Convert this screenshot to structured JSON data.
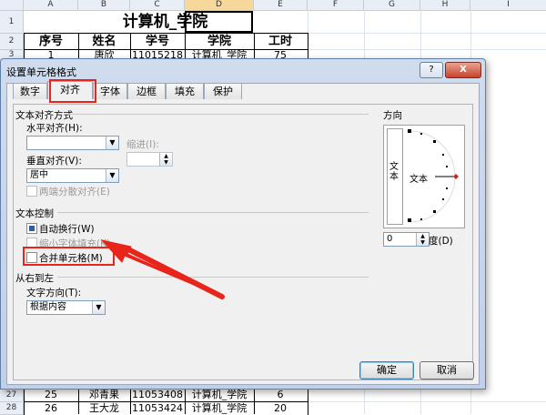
{
  "sheet": {
    "columns": [
      "A",
      "B",
      "C",
      "D",
      "E",
      "F",
      "G",
      "H",
      "I"
    ],
    "rows": [
      "1",
      "2",
      "3",
      "27",
      "28"
    ],
    "title": "计算机_学院",
    "headers": [
      "序号",
      "姓名",
      "学号",
      "学院",
      "工时"
    ],
    "row3": [
      "1",
      "唐欣",
      "11015218",
      "计算机_学院",
      "75"
    ],
    "row27": [
      "25",
      "邓青果",
      "11053408",
      "计算机_学院",
      "6"
    ],
    "row28": [
      "26",
      "王大龙",
      "11053424",
      "计算机_学院",
      "20"
    ]
  },
  "dialog": {
    "title": "设置单元格格式",
    "help_label": "?",
    "close_label": "X",
    "tabs": [
      "数字",
      "对齐",
      "字体",
      "边框",
      "填充",
      "保护"
    ],
    "alignment": {
      "section": "文本对齐方式",
      "horizontal_label": "水平对齐(H):",
      "horizontal_value": "",
      "indent_label": "缩进(I):",
      "indent_value": "",
      "vertical_label": "垂直对齐(V):",
      "vertical_value": "居中",
      "justify_distributed": "两端分散对齐(E)"
    },
    "text_control": {
      "section": "文本控制",
      "wrap": "自动换行(W)",
      "shrink": "缩小字体填充(K)",
      "merge": "合并单元格(M)"
    },
    "rtl": {
      "section": "从右到左",
      "direction_label": "文字方向(T):",
      "direction_value": "根据内容"
    },
    "orientation": {
      "section": "方向",
      "vertical_text": "文本",
      "horizontal_text": "文本",
      "degrees_value": "0",
      "degrees_label": "度(D)"
    },
    "ok_label": "确定",
    "cancel_label": "取消"
  }
}
